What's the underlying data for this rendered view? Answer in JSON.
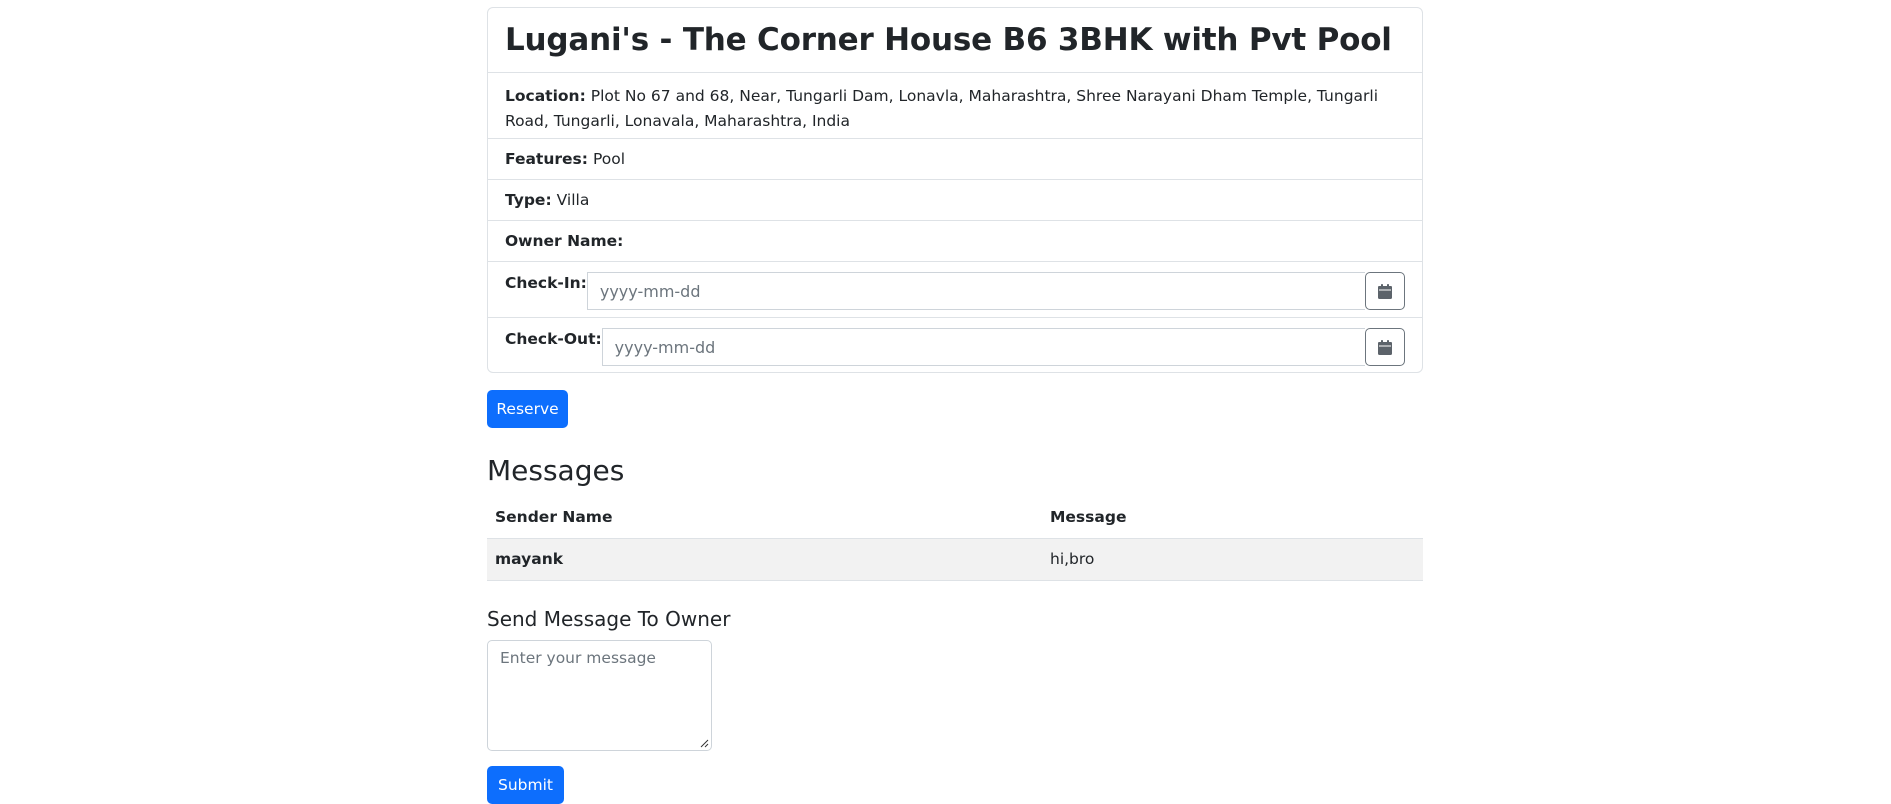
{
  "listing": {
    "title": "Lugani's - The Corner House B6 3BHK with Pvt Pool",
    "location_label": "Location:",
    "location_value": "Plot No 67 and 68, Near, Tungarli Dam, Lonavla, Maharashtra, Shree Narayani Dham Temple, Tungarli Road, Tungarli, Lonavala, Maharashtra, India",
    "features_label": "Features:",
    "features_value": "Pool",
    "type_label": "Type:",
    "type_value": "Villa",
    "owner_label": "Owner Name:",
    "owner_value": "",
    "checkin_label": "Check-In:",
    "checkin_placeholder": "yyyy-mm-dd",
    "checkout_label": "Check-Out:",
    "checkout_placeholder": "yyyy-mm-dd",
    "reserve_label": "Reserve"
  },
  "messages": {
    "title": "Messages",
    "columns": [
      "Sender Name",
      "Message"
    ],
    "rows": [
      {
        "sender": "mayank",
        "message": "hi,bro"
      }
    ]
  },
  "send": {
    "title": "Send Message To Owner",
    "placeholder": "Enter your message",
    "submit_label": "Submit"
  },
  "icons": {
    "calendar": "calendar-icon"
  },
  "colors": {
    "primary": "#0d6efd",
    "row_stripe": "#f2f2f2",
    "border": "#dee2e6"
  }
}
